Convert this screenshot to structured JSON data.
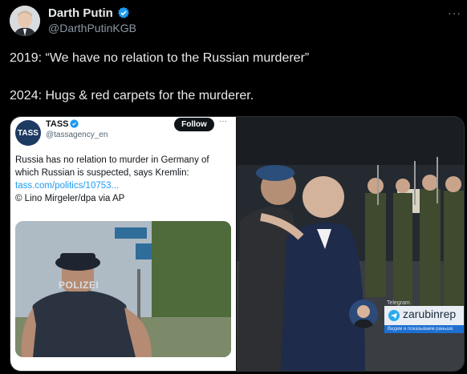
{
  "author": {
    "name": "Darth Putin",
    "handle": "@DarthPutinKGB",
    "avatar_icon": "avatar-portrait",
    "verified_icon": "verified-badge-icon"
  },
  "more_label": "···",
  "tweet": {
    "line1": "2019: “We have no relation to the Russian murderer”",
    "line2": "2024: Hugs & red carpets for the murderer."
  },
  "quoted": {
    "logo_text": "TASS",
    "name": "TASS",
    "handle": "@tassagency_en",
    "follow_label": "Follow",
    "more_label": "···",
    "text_lines": [
      "Russia has no relation to murder in Germany of",
      "which Russian is suspected, says Kremlin:"
    ],
    "link": "tass.com/politics/10753...",
    "credit": "© Lino Mirgeler/dpa via AP",
    "photo": {
      "vest_label": "POLIZEI"
    }
  },
  "video": {
    "channel_label": "Telegram",
    "channel_name": "zarubinrep",
    "subtitle": "Видим и показываем раньше"
  },
  "colors": {
    "background": "#000000",
    "text": "#e7e9ea",
    "muted": "#8b98a5",
    "link": "#1d9bf0",
    "verified": "#1d9bf0",
    "telegram": "#2aabee"
  }
}
